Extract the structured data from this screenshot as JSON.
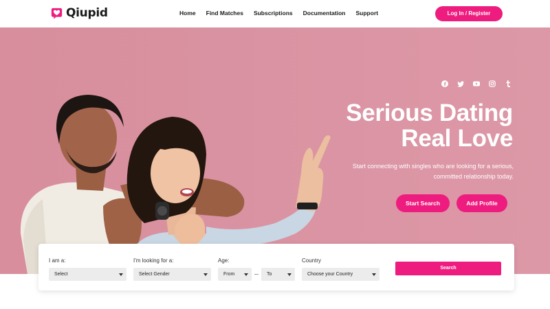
{
  "brand": {
    "name": "Qiupid",
    "accent_color": "#ee1c7f"
  },
  "nav": {
    "items": [
      {
        "label": "Home"
      },
      {
        "label": "Find Matches"
      },
      {
        "label": "Subscriptions"
      },
      {
        "label": "Documentation"
      },
      {
        "label": "Support"
      }
    ],
    "login_label": "Log In / Register"
  },
  "hero": {
    "socials": [
      "facebook-icon",
      "twitter-icon",
      "youtube-icon",
      "instagram-icon",
      "tumblr-icon"
    ],
    "title_line1": "Serious Dating",
    "title_line2": "Real Love",
    "subtitle_line1": "Start connecting with singles who are looking for a serious,",
    "subtitle_line2": "committed relationship today.",
    "start_search_label": "Start Search",
    "add_profile_label": "Add Profile",
    "background_color": "#d992a1"
  },
  "search": {
    "i_am_label": "I am a:",
    "i_am_value": "Select",
    "looking_label": "I'm looking for a:",
    "looking_value": "Select Gender",
    "age_label": "Age:",
    "age_from": "From",
    "age_to": "To",
    "country_label": "Country",
    "country_value": "Choose your Country",
    "search_label": "Search"
  }
}
